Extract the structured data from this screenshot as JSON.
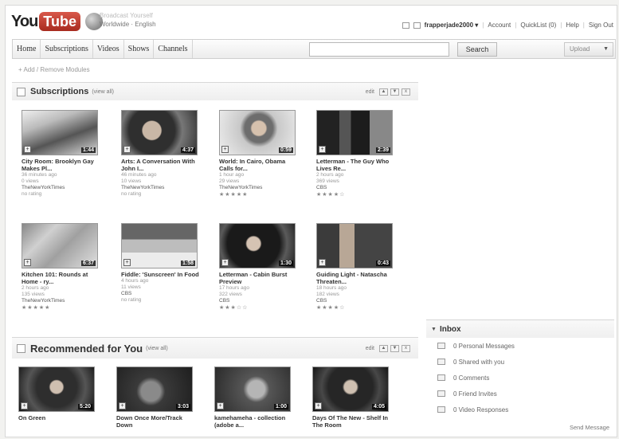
{
  "header": {
    "logo_you": "You",
    "logo_tube": "Tube",
    "locale_top": "Broadcast Yourself",
    "locale_bottom": "Worldwide · English",
    "username": "frapperjade2000 ▾",
    "links": [
      "Account",
      "QuickList (0)",
      "Help",
      "Sign Out"
    ]
  },
  "nav": {
    "tabs": [
      "Home",
      "Subscriptions",
      "Videos",
      "Shows",
      "Channels"
    ],
    "search_value": "",
    "search_button": "Search",
    "upload_button": "Upload"
  },
  "add_modules": "Add / Remove Modules",
  "subscriptions": {
    "title": "Subscriptions",
    "view_all": "(view all)",
    "edit": "edit",
    "videos": [
      {
        "title": "City Room: Brooklyn Gay Makes Pl...",
        "age": "36 minutes ago",
        "views": "0 views",
        "channel": "TheNewYorkTimes",
        "rating": "no rating",
        "duration": "1:44"
      },
      {
        "title": "Arts: A Conversation With John I...",
        "age": "46 minutes ago",
        "views": "10 views",
        "channel": "TheNewYorkTimes",
        "rating": "no rating",
        "duration": "4:37"
      },
      {
        "title": "World: In Cairo, Obama Calls for...",
        "age": "1 hour ago",
        "views": "29 views",
        "channel": "TheNewYorkTimes",
        "rating": "★★★★★",
        "duration": "0:59"
      },
      {
        "title": "Letterman - The Guy Who Lives Re...",
        "age": "2 hours ago",
        "views": "369 views",
        "channel": "CBS",
        "rating": "★★★★☆",
        "duration": "2:39"
      },
      {
        "title": "Kitchen 101: Rounds at Home - ry...",
        "age": "2 hours ago",
        "views": "135 views",
        "channel": "TheNewYorkTimes",
        "rating": "★★★★★",
        "duration": "6:37"
      },
      {
        "title": "Fiddle: 'Sunscreen' In Food",
        "age": "4 hours ago",
        "views": "11 views",
        "channel": "CBS",
        "rating": "no rating",
        "duration": "1:58"
      },
      {
        "title": "Letterman - Cabin Burst Preview",
        "age": "17 hours ago",
        "views": "322 views",
        "channel": "CBS",
        "rating": "★★★☆☆",
        "duration": "1:30"
      },
      {
        "title": "Guiding Light - Natascha Threaten...",
        "age": "18 hours ago",
        "views": "182 views",
        "channel": "CBS",
        "rating": "★★★★☆",
        "duration": "0:43"
      }
    ]
  },
  "recommended": {
    "title": "Recommended for You",
    "view_all": "(view all)",
    "edit": "edit",
    "videos": [
      {
        "title": "On Green",
        "duration": "5:20"
      },
      {
        "title": "Down Once More/Track Down",
        "duration": "3:03"
      },
      {
        "title": "kamehameha - collection (adobe a...",
        "duration": "1:00"
      },
      {
        "title": "Days Of The New - Shelf In The Room",
        "duration": "4:05"
      }
    ]
  },
  "inbox": {
    "title": "Inbox",
    "items": [
      {
        "label": "0 Personal Messages",
        "icon": "envelope-icon"
      },
      {
        "label": "0 Shared with you",
        "icon": "share-icon"
      },
      {
        "label": "0 Comments",
        "icon": "comment-icon"
      },
      {
        "label": "0 Friend Invites",
        "icon": "friend-icon"
      },
      {
        "label": "0 Video Responses",
        "icon": "video-response-icon"
      }
    ],
    "send_message": "Send Message"
  }
}
